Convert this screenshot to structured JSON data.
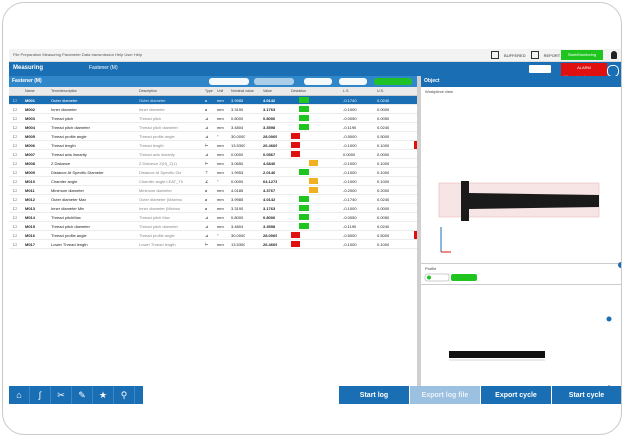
{
  "menubar": {
    "menu": "File  Preparation  Measuring  Parameter  Data transmission  Help  User  Help",
    "user_label": "BUFFERED",
    "report_label": "REPORT",
    "operator_label": "Operator",
    "status_label": "Start/Monitoring"
  },
  "titlebar": {
    "title": "Measuring",
    "program": "Fastener (M)"
  },
  "alarm": {
    "line1": "ALARM",
    "line2": "Measuring in progress"
  },
  "subbar": {
    "title": "Fastener (M)"
  },
  "viewer": {
    "header": "Object",
    "label": "Workpiece view",
    "panel_labels": [
      "Profile",
      "Diameter"
    ]
  },
  "table": {
    "columns": [
      "",
      "Name",
      "Term/description",
      "Description",
      "Type",
      "Unit",
      "Nominal value",
      "Value",
      "Deviation",
      "L.S.",
      "U.S."
    ],
    "rows": [
      {
        "id": "M001",
        "name": "Outer diameter",
        "desc": "Outer diameter",
        "type": "⌀",
        "unit": "mm",
        "nom": "3.9985",
        "val": "4.0142",
        "dev": "",
        "ls": "-0.1740",
        "us": "0.0240",
        "bar": "green",
        "sel": true
      },
      {
        "id": "M002",
        "name": "Inner diameter",
        "desc": "Inner diameter",
        "type": "⌀",
        "unit": "mm",
        "nom": "3.3190",
        "val": "3.1763",
        "dev": "",
        "ls": "-0.1000",
        "us": "0.0000",
        "bar": "green",
        "sel": false
      },
      {
        "id": "M003",
        "name": "Thread pitch",
        "desc": "Thread pitch",
        "type": "⊿",
        "unit": "mm",
        "nom": "0.8000",
        "val": "0.8006",
        "dev": "",
        "ls": "-0.0050",
        "us": "0.0050",
        "bar": "green",
        "sel": false
      },
      {
        "id": "M004",
        "name": "Thread pitch diameter",
        "desc": "Thread pitch diameter",
        "type": "⊿",
        "unit": "mm",
        "nom": "3.4804",
        "val": "3.3598",
        "dev": "",
        "ls": "-0.1190",
        "us": "0.0240",
        "bar": "green",
        "sel": false
      },
      {
        "id": "M005",
        "name": "Thread profile angle",
        "desc": "Thread profile angle",
        "type": "⊿",
        "unit": "°",
        "nom": "30.0000",
        "val": "28.0069",
        "dev": "",
        "ls": "-0.5000",
        "us": "0.5000",
        "bar": "red",
        "sel": false
      },
      {
        "id": "M006",
        "name": "Thread length",
        "desc": "Thread length",
        "type": "⊢",
        "unit": "mm",
        "nom": "13.5300",
        "val": "26.4669",
        "dev": "",
        "ls": "-0.1000",
        "us": "0.1000",
        "bar": "red",
        "sel": false
      },
      {
        "id": "M007",
        "name": "Thread axis linearity",
        "desc": "Thread axis linearity",
        "type": "⊿",
        "unit": "mm",
        "nom": "0.0000",
        "val": "0.0567",
        "dev": "",
        "ls": "0.0000",
        "us": "0.0000",
        "bar": "red",
        "sel": false
      },
      {
        "id": "M008",
        "name": "Z Distance",
        "desc": "Z Distance Z(H)_Z(1)",
        "type": "⊢",
        "unit": "mm",
        "nom": "3.0650",
        "val": "4.6840",
        "dev": "",
        "ls": "-0.1000",
        "us": "0.1000",
        "bar": "orange",
        "sel": false
      },
      {
        "id": "M009",
        "name": "Distance At Specific Diameter",
        "desc": "Distance At Specific Dia",
        "type": "⊤",
        "unit": "mm",
        "nom": "1.9953",
        "val": "2.0146",
        "dev": "",
        "ls": "-0.1000",
        "us": "0.1000",
        "bar": "green",
        "sel": false
      },
      {
        "id": "M010",
        "name": "Chamfer angle",
        "desc": "Chamfer angle LEAT_Th",
        "type": "∠",
        "unit": "°",
        "nom": "0.0000",
        "val": "64.1273",
        "dev": "",
        "ls": "-0.1000",
        "us": "0.1000",
        "bar": "orange",
        "sel": false
      },
      {
        "id": "M011",
        "name": "Minimum diameter",
        "desc": "Minimum diameter",
        "type": "⌀",
        "unit": "mm",
        "nom": "4.0185",
        "val": "4.3767",
        "dev": "",
        "ls": "-0.2000",
        "us": "0.2000",
        "bar": "orange",
        "sel": false
      },
      {
        "id": "M012",
        "name": "Outer diameter Max",
        "desc": "Outer diameter (Maximu",
        "type": "⌀",
        "unit": "mm",
        "nom": "3.9985",
        "val": "4.0142",
        "dev": "",
        "ls": "-0.1740",
        "us": "0.0240",
        "bar": "green",
        "sel": false
      },
      {
        "id": "M013",
        "name": "Inner diameter Min",
        "desc": "Inner diameter (Minimu",
        "type": "⌀",
        "unit": "mm",
        "nom": "3.3190",
        "val": "3.1763",
        "dev": "",
        "ls": "-0.1000",
        "us": "0.0000",
        "bar": "green",
        "sel": false
      },
      {
        "id": "M014",
        "name": "Thread pitchMax",
        "desc": "Thread pitch Max",
        "type": "⊿",
        "unit": "mm",
        "nom": "0.8000",
        "val": "0.8006",
        "dev": "",
        "ls": "-0.0050",
        "us": "0.0050",
        "bar": "green",
        "sel": false
      },
      {
        "id": "M015",
        "name": "Thread pitch diameter",
        "desc": "Thread pitch diameter",
        "type": "⊿",
        "unit": "mm",
        "nom": "3.4804",
        "val": "3.3598",
        "dev": "",
        "ls": "-0.1190",
        "us": "0.0240",
        "bar": "green",
        "sel": false
      },
      {
        "id": "M016",
        "name": "Thread profile angle",
        "desc": "Thread profile angle",
        "type": "⊿",
        "unit": "°",
        "nom": "30.0000",
        "val": "28.0069",
        "dev": "",
        "ls": "-0.5000",
        "us": "0.5000",
        "bar": "red",
        "sel": false
      },
      {
        "id": "M017",
        "name": "Lower Thread length",
        "desc": "Lower Thread length",
        "type": "⊢",
        "unit": "mm",
        "nom": "13.5300",
        "val": "26.4669",
        "dev": "",
        "ls": "-0.1000",
        "us": "0.1000",
        "bar": "red",
        "sel": false
      }
    ]
  },
  "bottom": {
    "start_log": "Start log",
    "export_log_file": "Export log file",
    "export_cycle": "Export cycle",
    "start_cycle": "Start cycle"
  },
  "colors": {
    "primary": "#1a6fb4",
    "green": "#1ec51e",
    "red": "#e01010",
    "orange": "#f0b020"
  }
}
